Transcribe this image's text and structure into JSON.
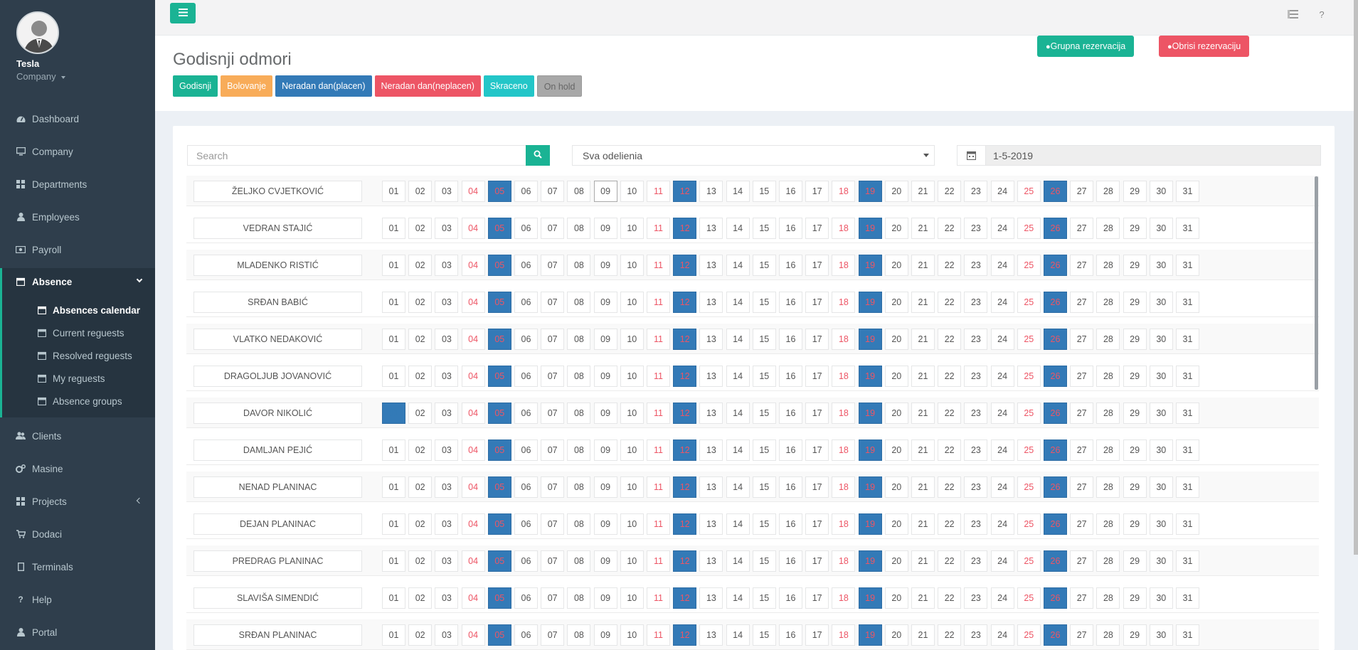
{
  "user": {
    "name": "Tesla",
    "company": "Company"
  },
  "sidebar": {
    "items": [
      {
        "label": "Dashboard",
        "icon": "dashboard-icon"
      },
      {
        "label": "Company",
        "icon": "desktop-icon"
      },
      {
        "label": "Departments",
        "icon": "grid-icon"
      },
      {
        "label": "Employees",
        "icon": "user-icon"
      },
      {
        "label": "Payroll",
        "icon": "money-icon"
      },
      {
        "label": "Absence",
        "icon": "calendar-icon"
      },
      {
        "label": "Clients",
        "icon": "users-icon"
      },
      {
        "label": "Masine",
        "icon": "cogs-icon"
      },
      {
        "label": "Projects",
        "icon": "grid-icon"
      },
      {
        "label": "Dodaci",
        "icon": "cart-icon"
      },
      {
        "label": "Terminals",
        "icon": "tablet-icon"
      },
      {
        "label": "Help",
        "icon": "question-icon"
      },
      {
        "label": "Portal",
        "icon": "user-icon"
      }
    ],
    "absence_sub": [
      "Absences calendar",
      "Current reguests",
      "Resolved reguests",
      "My reguests",
      "Absence groups"
    ]
  },
  "topbar": {
    "help": "?"
  },
  "header": {
    "title": "Godisnji odmori",
    "legend": [
      {
        "label": "Godisnji",
        "color": "#1ab394"
      },
      {
        "label": "Bolovanje",
        "color": "#f8ac59"
      },
      {
        "label": "Neradan dan(placen)",
        "color": "#337ab7"
      },
      {
        "label": "Neradan dan(neplacen)",
        "color": "#ed5565"
      },
      {
        "label": "Skraceno",
        "color": "#23c6c8"
      },
      {
        "label": "On hold",
        "color": "#a8a8a8"
      }
    ],
    "group_reservation": "Grupna rezervacija",
    "delete_reservation": "Obrisi rezervaciju"
  },
  "filters": {
    "search_placeholder": "Search",
    "department": "Sva odelienia",
    "date": "1-5-2019"
  },
  "calendar": {
    "days": [
      "01",
      "02",
      "03",
      "04",
      "05",
      "06",
      "07",
      "08",
      "09",
      "10",
      "11",
      "12",
      "13",
      "14",
      "15",
      "16",
      "17",
      "18",
      "19",
      "20",
      "21",
      "22",
      "23",
      "24",
      "25",
      "26",
      "27",
      "28",
      "29",
      "30",
      "31"
    ],
    "saturdays": [
      "04",
      "11",
      "18",
      "25"
    ],
    "sundays": [
      "05",
      "12",
      "19",
      "26"
    ],
    "today": "09",
    "employees": [
      {
        "name": "ŽELJKO CVJETKOVIĆ",
        "absences": []
      },
      {
        "name": "VEDRAN STAJIĆ",
        "absences": []
      },
      {
        "name": "MLADENKO RISTIĆ",
        "absences": []
      },
      {
        "name": "SRĐAN BABIĆ",
        "absences": []
      },
      {
        "name": "VLATKO NEDAKOVIĆ",
        "absences": []
      },
      {
        "name": "DRAGOLJUB JOVANOVIĆ",
        "absences": []
      },
      {
        "name": "DAVOR NIKOLIĆ",
        "absences": [
          "01"
        ]
      },
      {
        "name": "DAMLJAN PEJIĆ",
        "absences": []
      },
      {
        "name": "NENAD PLANINAC",
        "absences": []
      },
      {
        "name": "DEJAN PLANINAC",
        "absences": []
      },
      {
        "name": "PREDRAG PLANINAC",
        "absences": []
      },
      {
        "name": "SLAVIŠA SIMENDIĆ",
        "absences": []
      },
      {
        "name": "SRĐAN PLANINAC",
        "absences": []
      }
    ]
  }
}
